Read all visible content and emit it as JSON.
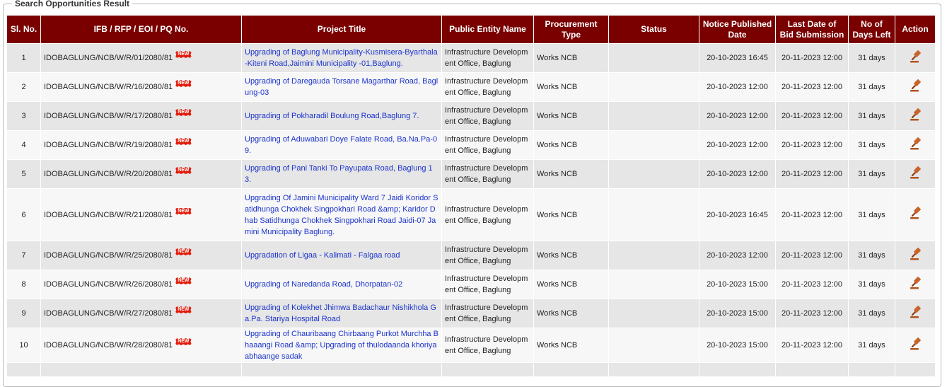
{
  "legend": "Search Opportunities Result",
  "headers": {
    "sl": "Sl. No.",
    "ifb": "IFB / RFP / EOI / PQ No.",
    "title": "Project Title",
    "entity": "Public Entity Name",
    "type_line1": "Procurement",
    "type_line2": "Type",
    "status": "Status",
    "notice_line1": "Notice Published",
    "notice_line2": "Date",
    "last_line1": "Last Date of",
    "last_line2": "Bid Submission",
    "days_line1": "No of",
    "days_line2": "Days Left",
    "action": "Action"
  },
  "new_badge": "NEW",
  "action_icon": "gavel-icon",
  "rows": [
    {
      "sl": "1",
      "ifb": "IDOBAGLUNG/NCB/W/R/01/2080/81",
      "title": "Upgrading of Baglung Municipality-Kusmisera-Byarthala-Kiteni Road,Jaimini Municipality -01,Baglung.",
      "entity": "Infrastructure Development Office, Baglung",
      "type": "Works  NCB",
      "status": "",
      "notice": "20-10-2023 16:45",
      "last": "20-11-2023 12:00",
      "days": "31 days"
    },
    {
      "sl": "2",
      "ifb": "IDOBAGLUNG/NCB/W/R/16/2080/81",
      "title": "Upgrading of Daregauda Torsane Magarthar Road, Baglung-03",
      "entity": "Infrastructure Development Office, Baglung",
      "type": "Works  NCB",
      "status": "",
      "notice": "20-10-2023 12:00",
      "last": "20-11-2023 12:00",
      "days": "31 days"
    },
    {
      "sl": "3",
      "ifb": "IDOBAGLUNG/NCB/W/R/17/2080/81",
      "title": "Upgrading of Pokharadil Boulung Road,Baglung 7.",
      "entity": "Infrastructure Development Office, Baglung",
      "type": "Works  NCB",
      "status": "",
      "notice": "20-10-2023 12:00",
      "last": "20-11-2023 12:00",
      "days": "31 days"
    },
    {
      "sl": "4",
      "ifb": "IDOBAGLUNG/NCB/W/R/19/2080/81",
      "title": "Upgrading of Aduwabari Doye Falate Road, Ba.Na.Pa-09.",
      "entity": "Infrastructure Development Office, Baglung",
      "type": "Works  NCB",
      "status": "",
      "notice": "20-10-2023 12:00",
      "last": "20-11-2023 12:00",
      "days": "31 days"
    },
    {
      "sl": "5",
      "ifb": "IDOBAGLUNG/NCB/W/R/20/2080/81",
      "title": "Upgrading of Pani Tanki To Payupata Road, Baglung 13.",
      "entity": "Infrastructure Development Office, Baglung",
      "type": "Works  NCB",
      "status": "",
      "notice": "20-10-2023 12:00",
      "last": "20-11-2023 12:00",
      "days": "31 days"
    },
    {
      "sl": "6",
      "ifb": "IDOBAGLUNG/NCB/W/R/21/2080/81",
      "title": "Upgrading Of Jamini Municipality Ward 7 Jaidi Koridor Satidhunga Chokhek Singpokhari Road &amp; Karidor Dhab Satidhunga Chokhek Singpokhari Road Jaidi-07 Jamini Municipality Baglung.",
      "entity": "Infrastructure Development Office, Baglung",
      "type": "Works  NCB",
      "status": "",
      "notice": "20-10-2023 16:45",
      "last": "20-11-2023 12:00",
      "days": "31 days"
    },
    {
      "sl": "7",
      "ifb": "IDOBAGLUNG/NCB/W/R/25/2080/81",
      "title": "Upgradation of Ligaa - Kalimati - Falgaa road",
      "entity": "Infrastructure Development Office, Baglung",
      "type": "Works  NCB",
      "status": "",
      "notice": "20-10-2023 12:00",
      "last": "20-11-2023 12:00",
      "days": "31 days"
    },
    {
      "sl": "8",
      "ifb": "IDOBAGLUNG/NCB/W/R/26/2080/81",
      "title": "Upgrading of Naredanda Road, Dhorpatan-02",
      "entity": "Infrastructure Development Office, Baglung",
      "type": "Works  NCB",
      "status": "",
      "notice": "20-10-2023 15:00",
      "last": "20-11-2023 12:00",
      "days": "31 days"
    },
    {
      "sl": "9",
      "ifb": "IDOBAGLUNG/NCB/W/R/27/2080/81",
      "title": "Upgrading of Kolekhet Jhimwa Badachaur Nishikhola Ga.Pa. Stariya Hospital Road",
      "entity": "Infrastructure Development Office, Baglung",
      "type": "Works  NCB",
      "status": "",
      "notice": "20-10-2023 15:00",
      "last": "20-11-2023 12:00",
      "days": "31 days"
    },
    {
      "sl": "10",
      "ifb": "IDOBAGLUNG/NCB/W/R/28/2080/81",
      "title": "Upgrading of Chauribaang Chirbaang Purkot Murchha Bhaaangi Road &amp; Upgrading of thulodaanda khoriya abhaange sadak",
      "entity": "Infrastructure Development Office, Baglung",
      "type": "Works  NCB",
      "status": "",
      "notice": "20-10-2023 15:00",
      "last": "20-11-2023 12:00",
      "days": "31 days"
    }
  ]
}
